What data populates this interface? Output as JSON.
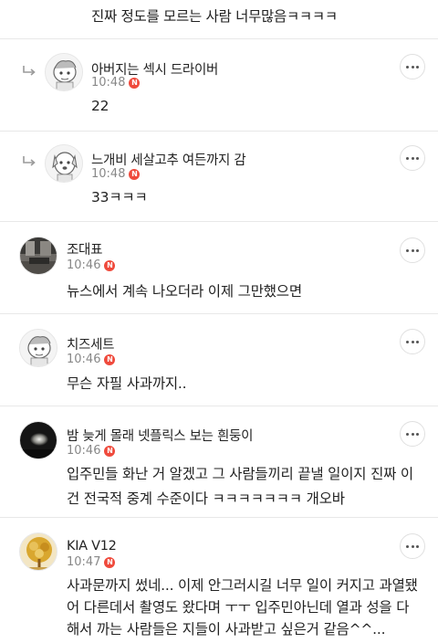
{
  "top_comment": {
    "text": "진짜 정도를 모르는 사람 너무많음ㅋㅋㅋㅋ"
  },
  "comments": [
    {
      "name": "아버지는 섹시 드라이버",
      "time": "10:48",
      "badge": "N",
      "text": "22",
      "reply": true,
      "avatar_icon": "cartoon-avatar-icon"
    },
    {
      "name": "느개비 세살고추 여든까지 감",
      "time": "10:48",
      "badge": "N",
      "text": "33ㅋㅋㅋ",
      "reply": true,
      "avatar_icon": "cartoon-dog-avatar-icon"
    },
    {
      "name": "조대표",
      "time": "10:46",
      "badge": "N",
      "text": "뉴스에서 계속 나오더라 이제 그만했으면",
      "reply": false,
      "avatar_icon": "room-photo-avatar-icon"
    },
    {
      "name": "치즈세트",
      "time": "10:46",
      "badge": "N",
      "text": "무슨 자필 사과까지..",
      "reply": false,
      "avatar_icon": "cartoon-avatar-icon"
    },
    {
      "name": "밤 늦게 몰래 넷플릭스 보는 흰둥이",
      "time": "10:46",
      "badge": "N",
      "text_lines": [
        "입주민들 화난 거 알겠고 그 사람들끼리 끝낼 일이지 진짜 이",
        "건 전국적 중계 수준이다 ㅋㅋㅋㅋㅋㅋㅋ 개오바"
      ],
      "reply": false,
      "avatar_icon": "tv-dark-avatar-icon"
    },
    {
      "name": "KIA V12",
      "time": "10:47",
      "badge": "N",
      "text_lines": [
        "사과문까지 썼네... 이제 안그러시길 너무 일이 커지고 과열됐",
        "어 다른데서 촬영도 왔다며 ㅜㅜ 입주민아닌데 열과 성을 다",
        "해서 까는 사람들은 지들이 사과받고 싶은거 같음^^..."
      ],
      "reply": false,
      "avatar_icon": "golden-tree-avatar-icon"
    }
  ],
  "more_label": "more-options"
}
